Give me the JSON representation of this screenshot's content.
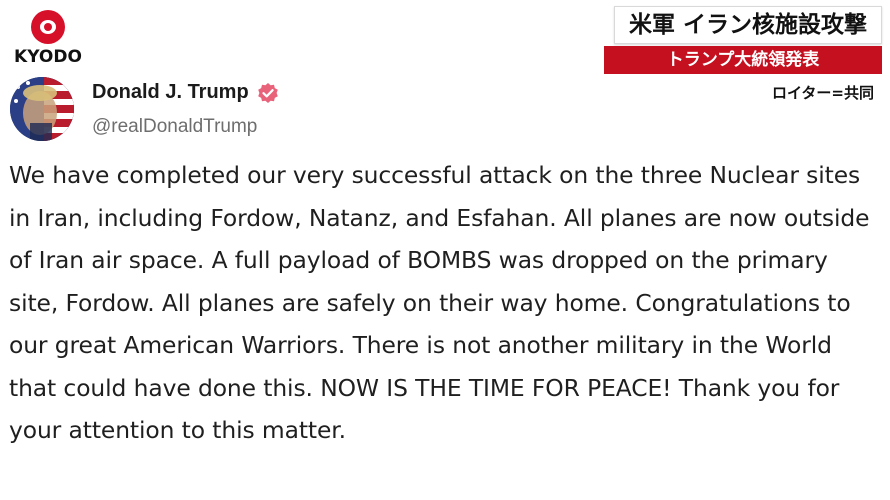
{
  "logo": {
    "text": "KYODO"
  },
  "captions": {
    "headline": "米軍 イラン核施設攻撃",
    "subheadline": "トランプ大統領発表",
    "credit": "ロイター=共同"
  },
  "post": {
    "author": {
      "name": "Donald J. Trump",
      "handle": "@realDonaldTrump",
      "verified": true
    },
    "text": "We have completed our very successful attack on the three Nuclear sites in Iran, including Fordow, Natanz, and Esfahan. All planes are now outside of Iran air space. A full payload of BOMBS was dropped on the primary site, Fordow. All planes are safely on their way home. Congratulations to our great American Warriors. There is not another military in the World that could have done this. NOW IS THE TIME FOR PEACE! Thank you for your attention to this matter."
  },
  "colors": {
    "caption_red": "#c4101f",
    "kyodo_red": "#d7102a",
    "verified_badge": "#e8627a",
    "handle_gray": "#6e6e6e"
  },
  "icons": {
    "verified": "verified-badge-icon",
    "logo_mark": "kyodo-logo-mark-icon"
  }
}
